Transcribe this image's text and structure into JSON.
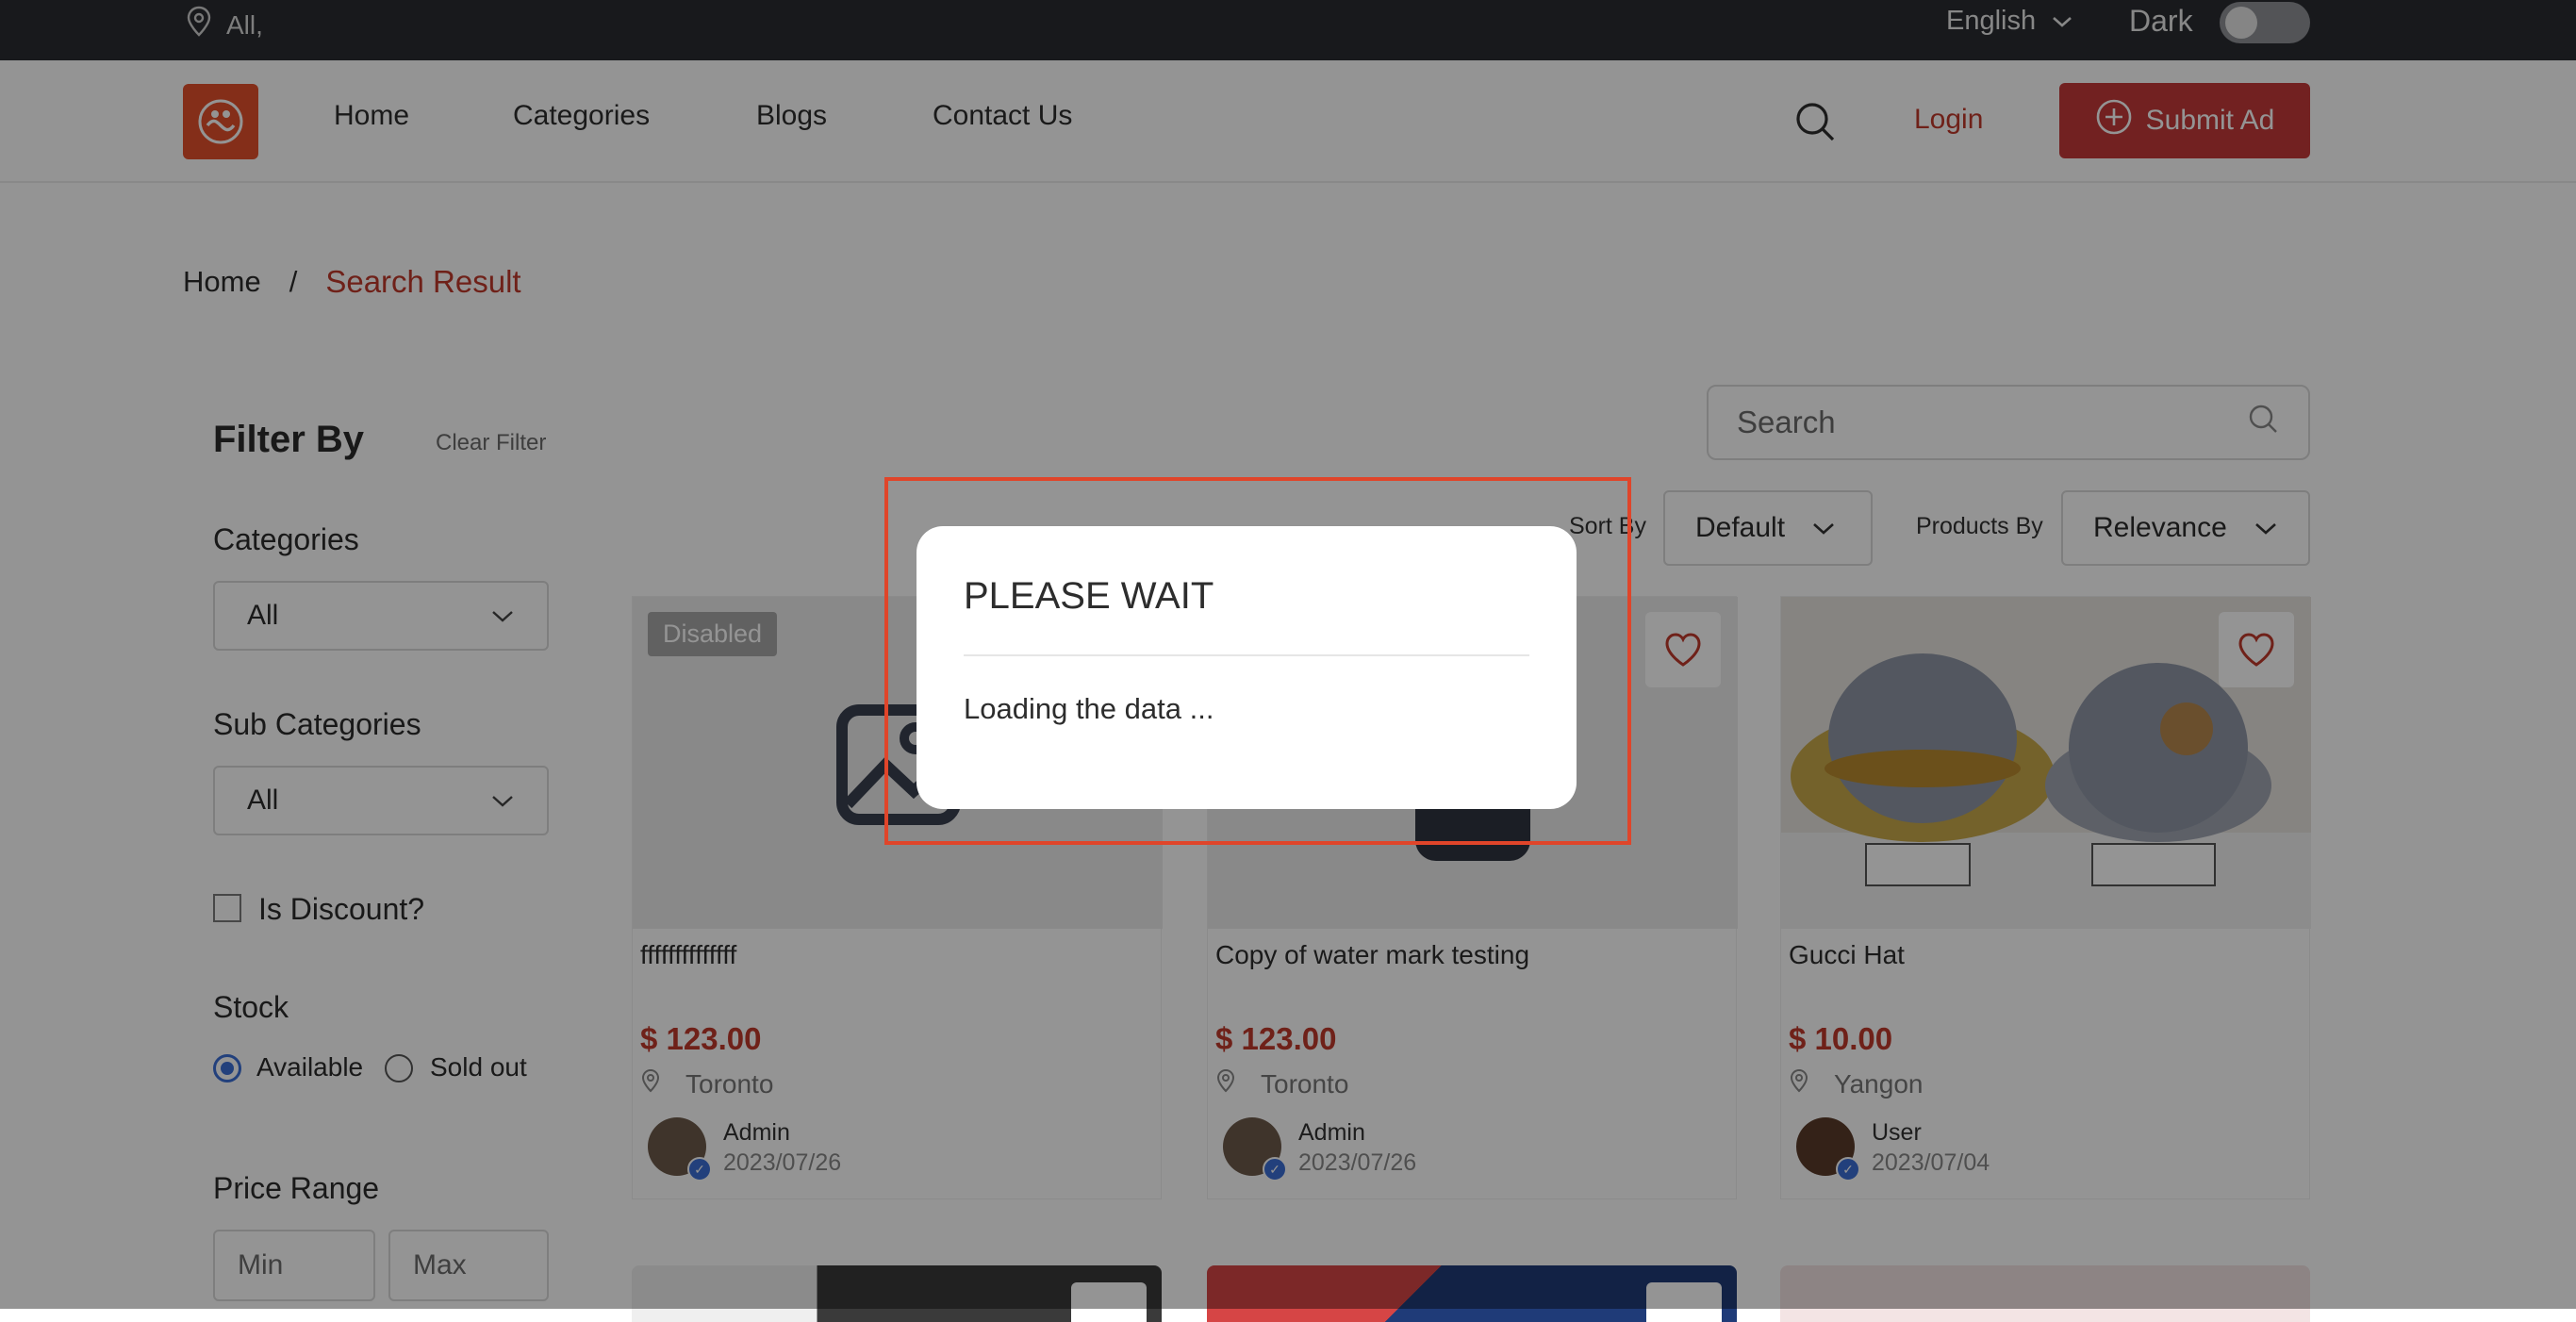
{
  "topbar": {
    "location": "All,",
    "language": "English",
    "dark_label": "Dark"
  },
  "nav": {
    "home": "Home",
    "categories": "Categories",
    "blogs": "Blogs",
    "contact": "Contact Us",
    "login": "Login",
    "submit_ad": "Submit Ad"
  },
  "breadcrumb": {
    "home": "Home",
    "separator": "/",
    "current": "Search Result"
  },
  "filter": {
    "title": "Filter By",
    "clear": "Clear Filter",
    "categories_label": "Categories",
    "categories_value": "All",
    "subcategories_label": "Sub Categories",
    "subcategories_value": "All",
    "discount_label": "Is Discount?",
    "stock_label": "Stock",
    "stock_available": "Available",
    "stock_soldout": "Sold out",
    "price_label": "Price Range",
    "min_placeholder": "Min",
    "max_placeholder": "Max"
  },
  "toolbar": {
    "search_placeholder": "Search",
    "sort_label": "Sort By",
    "sort_value": "Default",
    "products_label": "Products By",
    "products_value": "Relevance"
  },
  "products": [
    {
      "badge": "Disabled",
      "title": "ffffffffffffff",
      "price": "$ 123.00",
      "city": "Toronto",
      "author": "Admin",
      "date": "2023/07/26"
    },
    {
      "badge": "",
      "title": "Copy of water mark testing",
      "price": "$ 123.00",
      "city": "Toronto",
      "author": "Admin",
      "date": "2023/07/26"
    },
    {
      "badge": "",
      "title": "Gucci Hat",
      "price": "$ 10.00",
      "city": "Yangon",
      "author": "User",
      "date": "2023/07/04"
    }
  ],
  "modal": {
    "title": "PLEASE WAIT",
    "message": "Loading the data ..."
  },
  "colors": {
    "brand": "#c43a3a",
    "accent_blue": "#3b6fd6",
    "highlight": "#e0452a"
  }
}
